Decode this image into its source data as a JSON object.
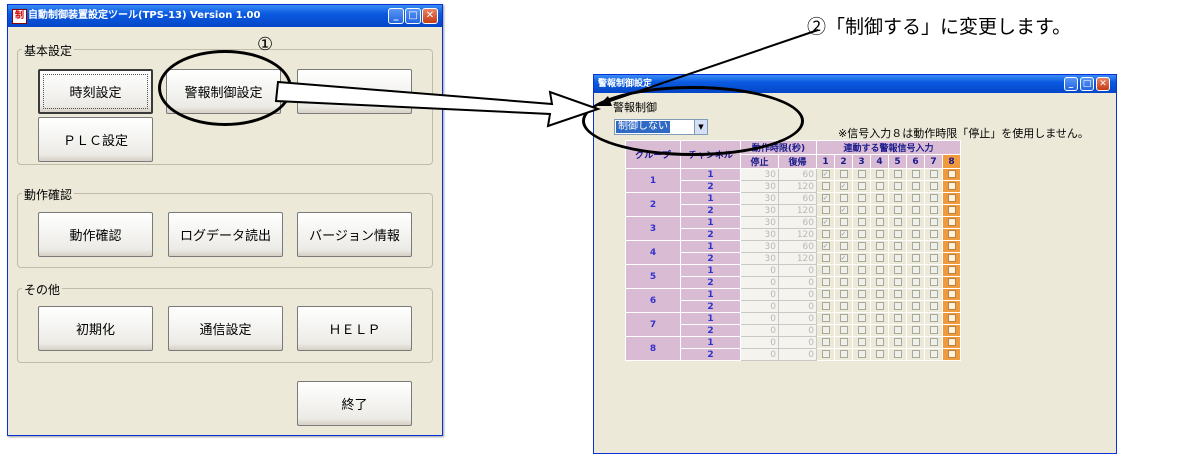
{
  "window1": {
    "title": "自動制御装置設定ツール(TPS-13) Version 1.00",
    "app_icon_glyph": "制",
    "groups": {
      "basic": {
        "label": "基本設定",
        "buttons": [
          "時刻設定",
          "警報制御設定",
          "",
          "ＰＬＣ設定"
        ]
      },
      "operation": {
        "label": "動作確認",
        "buttons": [
          "動作確認",
          "ログデータ読出",
          "バージョン情報"
        ]
      },
      "other": {
        "label": "その他",
        "buttons": [
          "初期化",
          "通信設定",
          "ＨＥＬＰ"
        ]
      }
    },
    "exit_button": "終了"
  },
  "annotations": {
    "step1": "①",
    "step2": "②「制御する」に変更します。"
  },
  "window2": {
    "title": "警報制御設定",
    "group_label": "警報制御",
    "select_value": "制御しない",
    "note": "※信号入力８は動作時限「停止」を使用しません。",
    "headers": {
      "group": "グループ",
      "channel": "チャンネル",
      "time_limit": "動作時限(秒)",
      "stop": "停止",
      "recover": "復帰",
      "linked_signal": "連動する警報信号入力",
      "signal_numbers": [
        "1",
        "2",
        "3",
        "4",
        "5",
        "6",
        "7",
        "8"
      ]
    },
    "groups": [
      {
        "group": "1",
        "rows": [
          {
            "ch": "1",
            "stop": "30",
            "recover": "60",
            "checks": [
              1,
              0,
              0,
              0,
              0,
              0,
              0,
              0
            ]
          },
          {
            "ch": "2",
            "stop": "30",
            "recover": "120",
            "checks": [
              0,
              1,
              0,
              0,
              0,
              0,
              0,
              0
            ]
          }
        ]
      },
      {
        "group": "2",
        "rows": [
          {
            "ch": "1",
            "stop": "30",
            "recover": "60",
            "checks": [
              1,
              0,
              0,
              0,
              0,
              0,
              0,
              0
            ]
          },
          {
            "ch": "2",
            "stop": "30",
            "recover": "120",
            "checks": [
              0,
              1,
              0,
              0,
              0,
              0,
              0,
              0
            ]
          }
        ]
      },
      {
        "group": "3",
        "rows": [
          {
            "ch": "1",
            "stop": "30",
            "recover": "60",
            "checks": [
              1,
              0,
              0,
              0,
              0,
              0,
              0,
              0
            ]
          },
          {
            "ch": "2",
            "stop": "30",
            "recover": "120",
            "checks": [
              0,
              1,
              0,
              0,
              0,
              0,
              0,
              0
            ]
          }
        ]
      },
      {
        "group": "4",
        "rows": [
          {
            "ch": "1",
            "stop": "30",
            "recover": "60",
            "checks": [
              1,
              0,
              0,
              0,
              0,
              0,
              0,
              0
            ]
          },
          {
            "ch": "2",
            "stop": "30",
            "recover": "120",
            "checks": [
              0,
              1,
              0,
              0,
              0,
              0,
              0,
              0
            ]
          }
        ]
      },
      {
        "group": "5",
        "rows": [
          {
            "ch": "1",
            "stop": "0",
            "recover": "0",
            "checks": [
              0,
              0,
              0,
              0,
              0,
              0,
              0,
              0
            ]
          },
          {
            "ch": "2",
            "stop": "0",
            "recover": "0",
            "checks": [
              0,
              0,
              0,
              0,
              0,
              0,
              0,
              0
            ]
          }
        ]
      },
      {
        "group": "6",
        "rows": [
          {
            "ch": "1",
            "stop": "0",
            "recover": "0",
            "checks": [
              0,
              0,
              0,
              0,
              0,
              0,
              0,
              0
            ]
          },
          {
            "ch": "2",
            "stop": "0",
            "recover": "0",
            "checks": [
              0,
              0,
              0,
              0,
              0,
              0,
              0,
              0
            ]
          }
        ]
      },
      {
        "group": "7",
        "rows": [
          {
            "ch": "1",
            "stop": "0",
            "recover": "0",
            "checks": [
              0,
              0,
              0,
              0,
              0,
              0,
              0,
              0
            ]
          },
          {
            "ch": "2",
            "stop": "0",
            "recover": "0",
            "checks": [
              0,
              0,
              0,
              0,
              0,
              0,
              0,
              0
            ]
          }
        ]
      },
      {
        "group": "8",
        "rows": [
          {
            "ch": "1",
            "stop": "0",
            "recover": "0",
            "checks": [
              0,
              0,
              0,
              0,
              0,
              0,
              0,
              0
            ]
          },
          {
            "ch": "2",
            "stop": "0",
            "recover": "0",
            "checks": [
              0,
              0,
              0,
              0,
              0,
              0,
              0,
              0
            ]
          }
        ]
      }
    ]
  }
}
